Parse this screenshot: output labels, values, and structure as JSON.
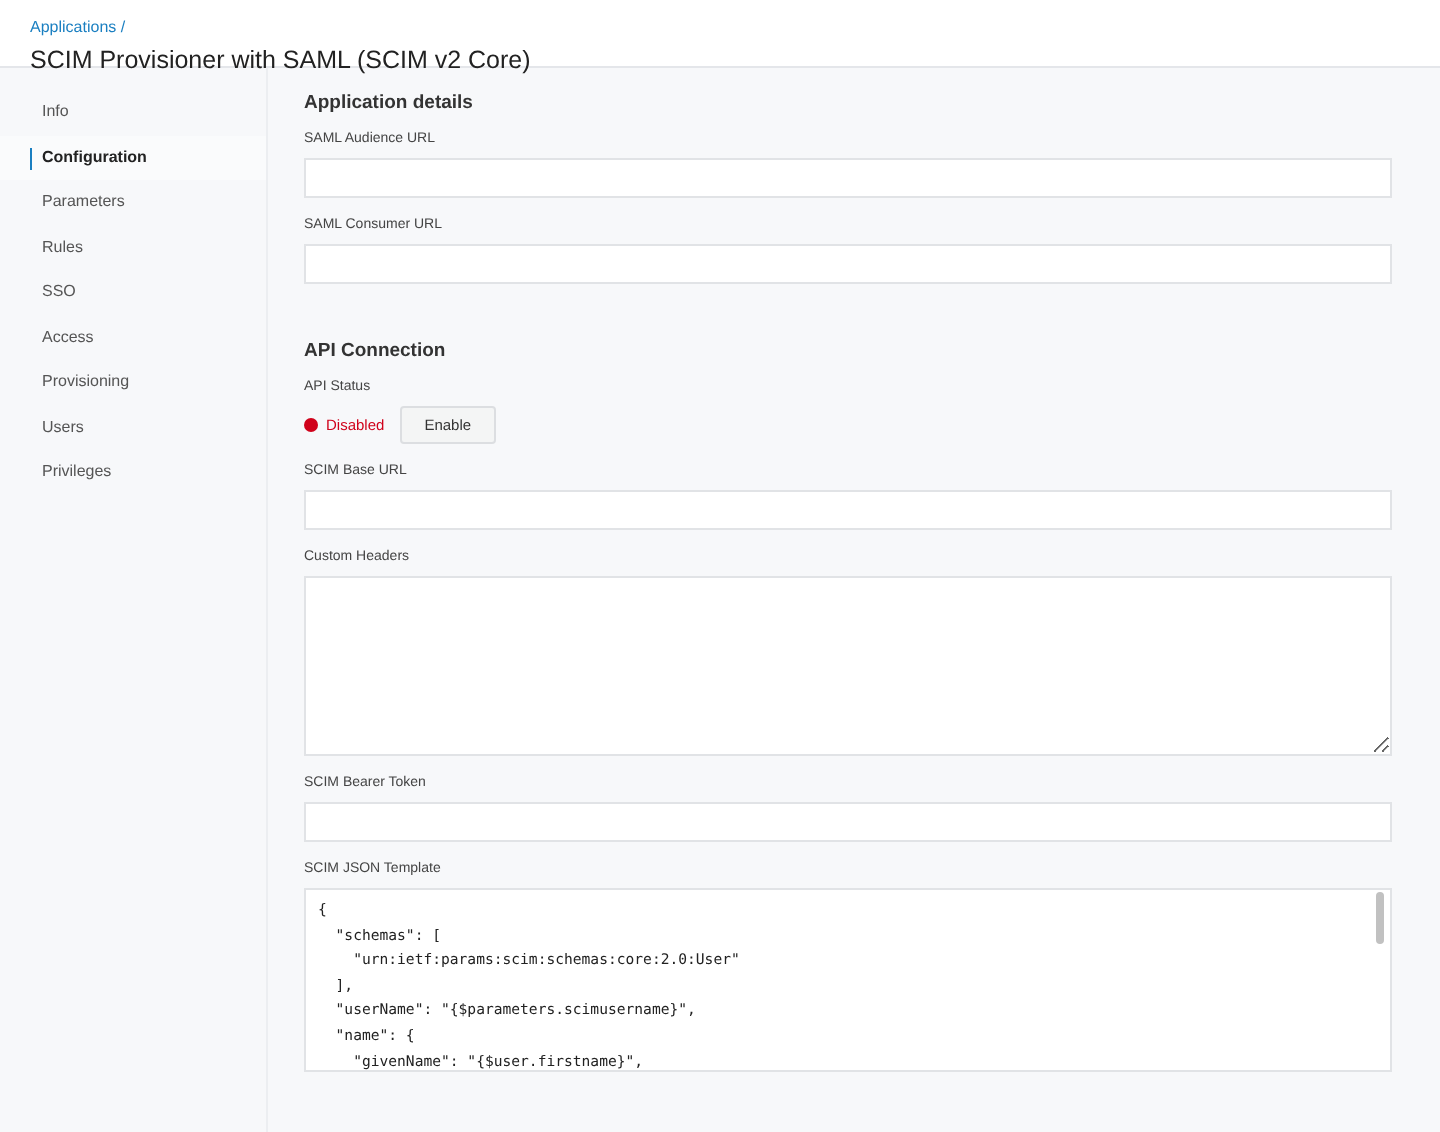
{
  "breadcrumb": "Applications /",
  "title": "SCIM Provisioner with SAML (SCIM v2 Core)",
  "sidebar": {
    "items": [
      {
        "label": "Info",
        "selected": false
      },
      {
        "label": "Configuration",
        "selected": true
      },
      {
        "label": "Parameters",
        "selected": false
      },
      {
        "label": "Rules",
        "selected": false
      },
      {
        "label": "SSO",
        "selected": false
      },
      {
        "label": "Access",
        "selected": false
      },
      {
        "label": "Provisioning",
        "selected": false
      },
      {
        "label": "Users",
        "selected": false
      },
      {
        "label": "Privileges",
        "selected": false
      }
    ]
  },
  "sections": [
    {
      "heading": "Application details",
      "fields": [
        {
          "kind": "input",
          "label": "SAML Audience URL"
        },
        {
          "kind": "input",
          "label": "SAML Consumer URL"
        }
      ]
    },
    {
      "heading": "API Connection",
      "fields": [
        {
          "kind": "status",
          "label": "API Status",
          "status": "Disabled",
          "color": "#d0021b",
          "button": "Enable"
        },
        {
          "kind": "input",
          "label": "SCIM Base URL"
        },
        {
          "kind": "textarea",
          "label": "Custom Headers"
        },
        {
          "kind": "input",
          "label": "SCIM Bearer Token"
        },
        {
          "kind": "code",
          "label": "SCIM JSON Template",
          "lines": [
            "{",
            "  \"schemas\": [",
            "    \"urn:ietf:params:scim:schemas:core:2.0:User\"",
            "  ],",
            "  \"userName\": \"{$parameters.scimusername}\",",
            "  \"name\": {",
            "    \"givenName\": \"{$user.firstname}\","
          ]
        }
      ]
    }
  ]
}
